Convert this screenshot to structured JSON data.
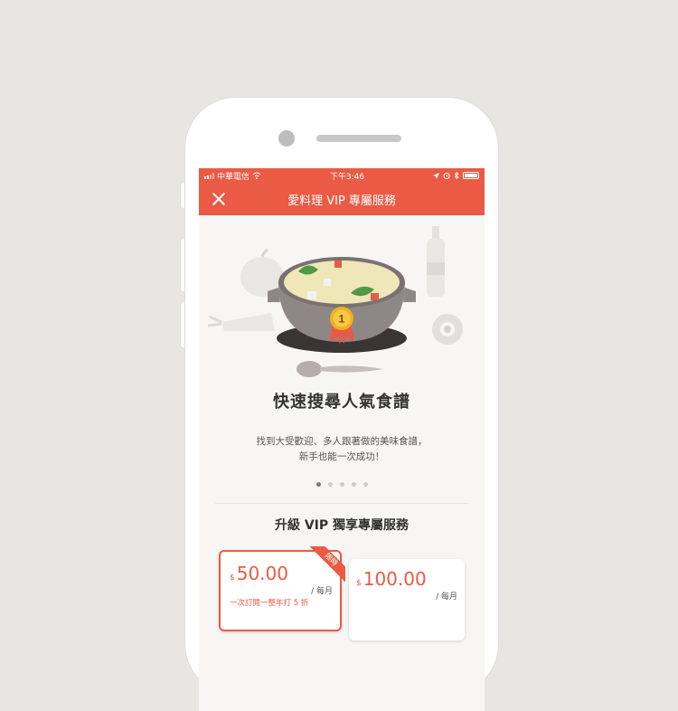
{
  "status_bar": {
    "carrier": "中華電信",
    "time": "下午3:46"
  },
  "nav": {
    "title": "愛料理 VIP 專屬服務",
    "close_icon": "close-icon"
  },
  "feature": {
    "title": "快速搜尋人氣食譜",
    "desc_line1": "找到大受歡迎、多人跟著做的美味食譜，",
    "desc_line2": "新手也能一次成功！",
    "badge_number": "1",
    "carousel_pages": 5,
    "carousel_active": 1
  },
  "upgrade_title": "升級 VIP 獨享專屬服務",
  "plans": [
    {
      "currency": "$",
      "price": "50.00",
      "period": "/ 每月",
      "note": "一次訂閱一整年打 5 折",
      "ribbon": "限時"
    },
    {
      "currency": "$",
      "price": "100.00",
      "period": "/ 每月"
    }
  ],
  "colors": {
    "brand": "#ea5a44",
    "background": "#f7f6f4"
  }
}
